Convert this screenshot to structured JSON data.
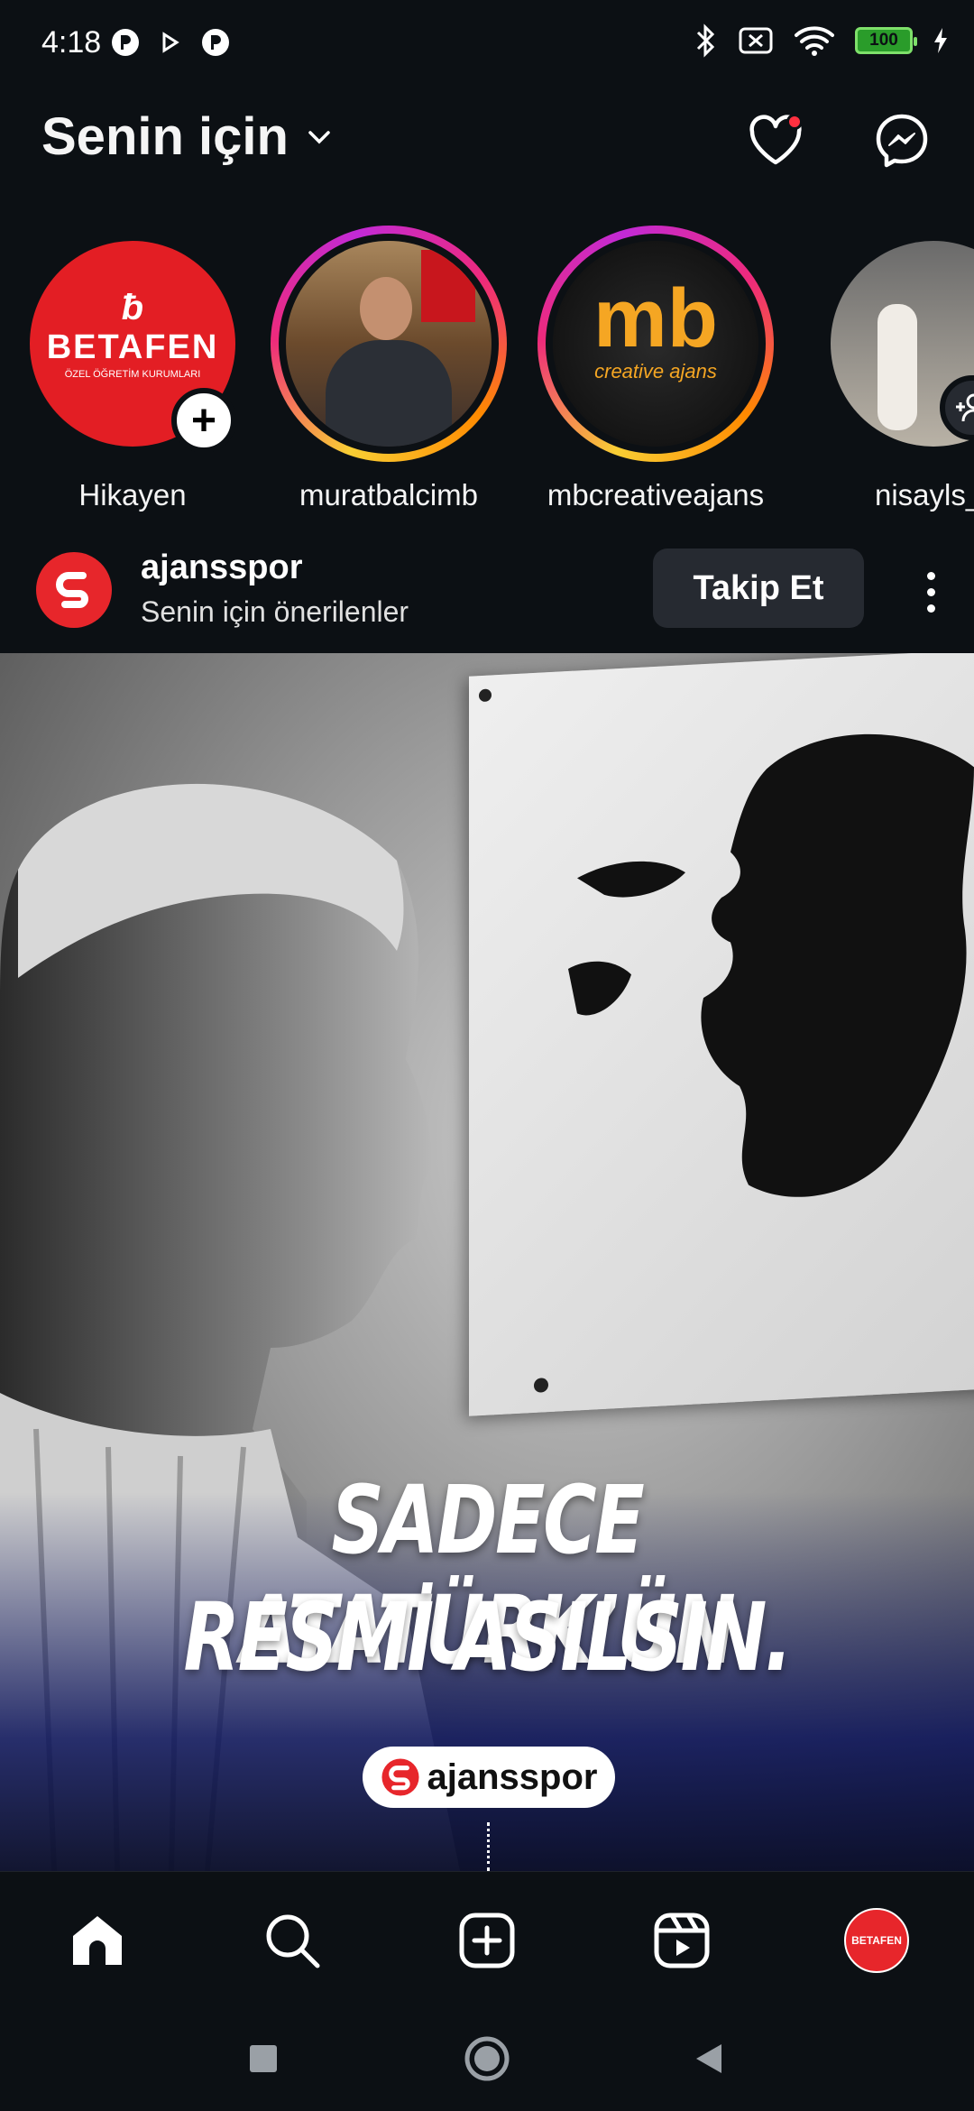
{
  "status_bar": {
    "time": "4:18",
    "battery": "100"
  },
  "header": {
    "title": "Senin için"
  },
  "stories": [
    {
      "username": "Hikayen",
      "avatar_text": "BETAFEN",
      "avatar_subtext": "ÖZEL ÖĞRETİM KURUMLARI",
      "is_own": true
    },
    {
      "username": "muratbalcimb",
      "is_own": false
    },
    {
      "username": "mbcreativeajans",
      "avatar_text": "mb",
      "avatar_subtext": "creative ajans",
      "is_own": false
    },
    {
      "username": "nisayls_",
      "is_own": false
    }
  ],
  "post": {
    "username": "ajansspor",
    "subtitle": "Senin için önerilenler",
    "follow_label": "Takip Et",
    "headline_line1": "SADECE ATATÜRK’ÜN",
    "headline_line2": "RESMİ ASILSIN.",
    "brand": "ajansspor"
  },
  "bottom_nav": {
    "profile_avatar_text": "BETAFEN"
  },
  "colors": {
    "background": "#0c1014",
    "notification": "#ff3040",
    "brand_red": "#e7262b",
    "follow_button": "#262a31"
  }
}
